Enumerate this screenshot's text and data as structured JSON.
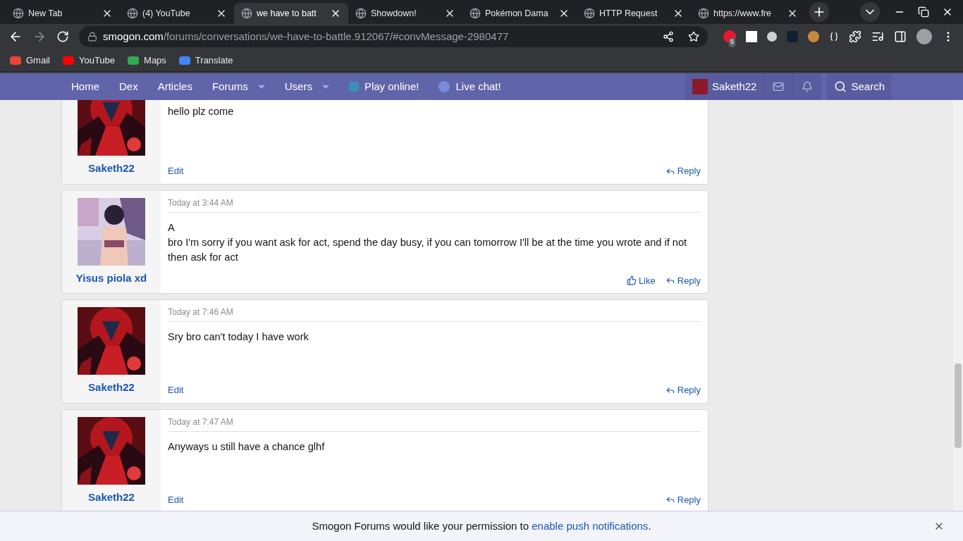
{
  "browser": {
    "tabs": [
      {
        "title": "New Tab",
        "selected": false
      },
      {
        "title": "(4) YouTube",
        "selected": false
      },
      {
        "title": "we have to batt",
        "selected": true
      },
      {
        "title": "Showdown!",
        "selected": false
      },
      {
        "title": "Pokémon Dama",
        "selected": false
      },
      {
        "title": "HTTP Request",
        "selected": false
      },
      {
        "title": "https://www.fre",
        "selected": false
      }
    ],
    "address": {
      "host": "smogon.com",
      "path": "/forums/conversations/we-have-to-battle.912067/#convMessage-2980477"
    },
    "extension_badge": "5",
    "bookmarks": [
      "Gmail",
      "YouTube",
      "Maps",
      "Translate"
    ]
  },
  "nav": {
    "items": [
      {
        "label": "Home",
        "dropdown": false
      },
      {
        "label": "Dex",
        "dropdown": false
      },
      {
        "label": "Articles",
        "dropdown": false
      },
      {
        "label": "Forums",
        "dropdown": true
      },
      {
        "label": "Users",
        "dropdown": true
      },
      {
        "label": "Play online!",
        "dropdown": false
      },
      {
        "label": "Live chat!",
        "dropdown": false
      }
    ],
    "user": "Saketh22",
    "search": "Search"
  },
  "messages": [
    {
      "author": "Saketh22",
      "own": true,
      "body": [
        "hello plz come"
      ],
      "actions": [
        {
          "kind": "edit",
          "label": "Edit"
        },
        {
          "kind": "reply",
          "label": "Reply"
        }
      ]
    },
    {
      "author": "Yisus piola xd",
      "own": false,
      "time": "Today at 3:44 AM",
      "body": [
        "A",
        "bro I'm sorry if you want ask for act, spend the day busy, if you can tomorrow I'll be at the time you wrote and if not then ask for act"
      ],
      "actions": [
        {
          "kind": "like",
          "label": "Like"
        },
        {
          "kind": "reply",
          "label": "Reply"
        }
      ]
    },
    {
      "author": "Saketh22",
      "own": true,
      "time": "Today at 7:46 AM",
      "body": [
        "Sry bro can't today I have work"
      ],
      "actions": [
        {
          "kind": "edit",
          "label": "Edit"
        },
        {
          "kind": "reply",
          "label": "Reply"
        }
      ]
    },
    {
      "author": "Saketh22",
      "own": true,
      "time": "Today at 7:47 AM",
      "body": [
        "Anyways u still have a chance glhf"
      ],
      "actions": [
        {
          "kind": "edit",
          "label": "Edit"
        },
        {
          "kind": "reply",
          "label": "Reply"
        }
      ]
    }
  ],
  "notification": {
    "text": "Smogon Forums would like your permission to ",
    "link": "enable push notifications",
    "end": "."
  }
}
